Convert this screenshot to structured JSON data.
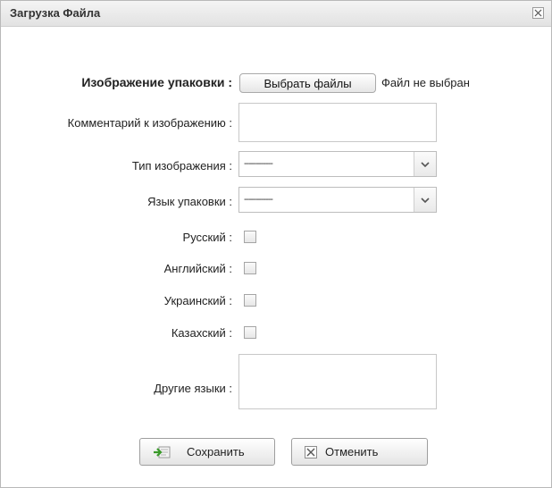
{
  "dialog": {
    "title": "Загрузка Файла",
    "close_icon": "close-icon"
  },
  "form": {
    "image_label": "Изображение упаковки :",
    "choose_files_label": "Выбрать файлы",
    "file_status": "Файл не выбран",
    "comment_label": "Комментарий к изображению :",
    "comment_value": "",
    "image_type_label": "Тип изображения :",
    "image_type_value": "------------",
    "package_lang_label": "Язык упаковки :",
    "package_lang_value": "------------",
    "languages": [
      {
        "label": "Русский :",
        "checked": false
      },
      {
        "label": "Английский :",
        "checked": false
      },
      {
        "label": "Украинский :",
        "checked": false
      },
      {
        "label": "Казахский :",
        "checked": false
      }
    ],
    "other_langs_label": "Другие языки :",
    "other_langs_value": ""
  },
  "buttons": {
    "save_label": "Сохранить",
    "save_icon": "save-arrow-icon",
    "cancel_label": "Отменить",
    "cancel_icon": "cancel-x-icon"
  }
}
